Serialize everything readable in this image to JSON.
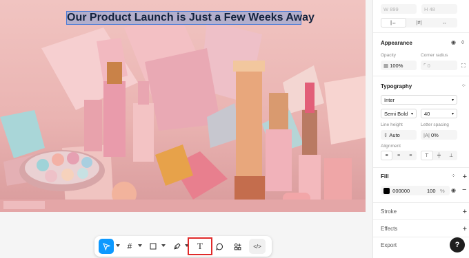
{
  "canvas": {
    "headline": "Our Product Launch is Just a Few Weeks Away",
    "image_name": "cosmetics-product-photo"
  },
  "toolbar": {
    "tools": [
      {
        "name": "move-tool",
        "icon": "cursor-icon",
        "glyph": "➤"
      },
      {
        "name": "frame-tool",
        "icon": "hash-frame-icon",
        "glyph": "#"
      },
      {
        "name": "shape-tool",
        "icon": "square-icon",
        "glyph": "□"
      },
      {
        "name": "pen-tool",
        "icon": "pen-icon",
        "glyph": "✒"
      },
      {
        "name": "text-tool",
        "icon": "text-icon",
        "glyph": "T"
      },
      {
        "name": "comment-tool",
        "icon": "comment-icon",
        "glyph": "◯"
      },
      {
        "name": "actions-tool",
        "icon": "actions-icon",
        "glyph": "⁂"
      },
      {
        "name": "dev-mode-toggle",
        "icon": "code-icon",
        "glyph": "</>"
      }
    ],
    "active_tool": "move-tool",
    "highlighted_tool": "text-tool"
  },
  "panel": {
    "size": {
      "w_label": "W",
      "w_value": "899",
      "h_label": "H",
      "h_value": "48"
    },
    "layout_segments": [
      "|↔",
      "|#|",
      "↔"
    ],
    "appearance": {
      "title": "Appearance",
      "opacity_label": "Opacity",
      "opacity_value": "100%",
      "radius_label": "Corner radius",
      "radius_value": "0"
    },
    "typography": {
      "title": "Typography",
      "font": "Inter",
      "weight": "Semi Bold",
      "size": "40",
      "line_height_label": "Line height",
      "line_height_value": "Auto",
      "letter_spacing_label": "Letter spacing",
      "letter_spacing_value": "0%",
      "alignment_label": "Alignment"
    },
    "fill": {
      "title": "Fill",
      "hex": "000000",
      "opacity": "100",
      "unit": "%",
      "swatch_color": "#000000"
    },
    "stroke_title": "Stroke",
    "effects_title": "Effects",
    "export_title": "Export",
    "help_label": "?"
  },
  "colors": {
    "accent": "#0d99ff",
    "highlight_box": "#e02a2a",
    "selection": "#4a7bd8"
  }
}
